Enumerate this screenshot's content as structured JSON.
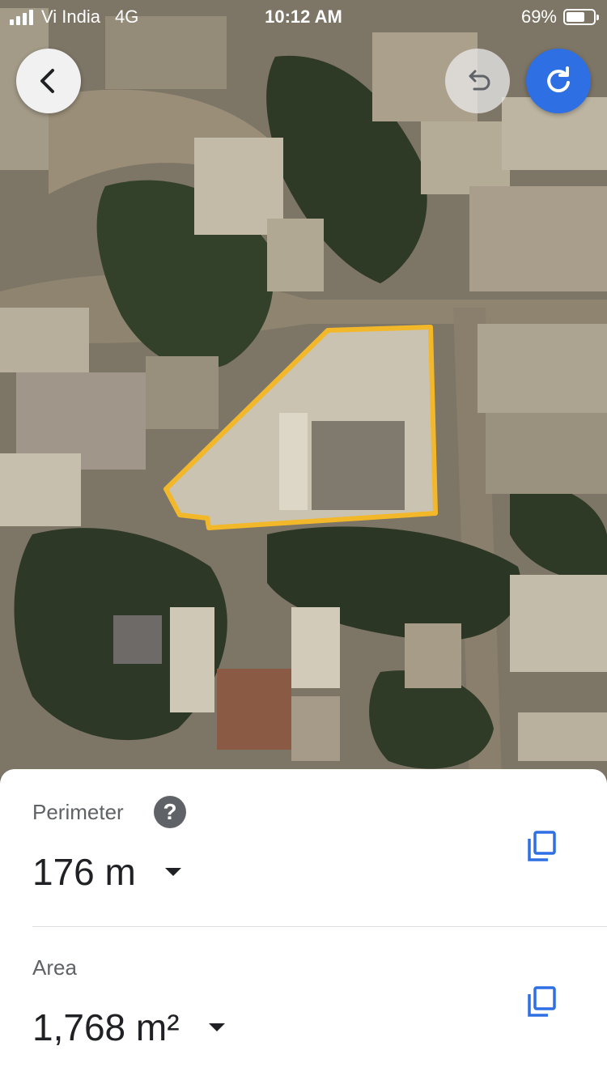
{
  "status_bar": {
    "carrier": "Vi India",
    "network": "4G",
    "time": "10:12 AM",
    "battery_percent_text": "69%",
    "battery_level": 0.69,
    "signal_bars": 4
  },
  "map": {
    "back_icon": "chevron-left-icon",
    "undo_icon": "undo-icon",
    "redo_icon": "redo-icon",
    "outline_color": "#f2b829",
    "accent_color": "#2f6fe4"
  },
  "measurements": {
    "perimeter": {
      "label": "Perimeter",
      "value": "176 m",
      "help_icon": "question-mark-icon",
      "copy_icon": "copy-icon"
    },
    "area": {
      "label": "Area",
      "value": "1,768 m²",
      "copy_icon": "copy-icon"
    }
  }
}
